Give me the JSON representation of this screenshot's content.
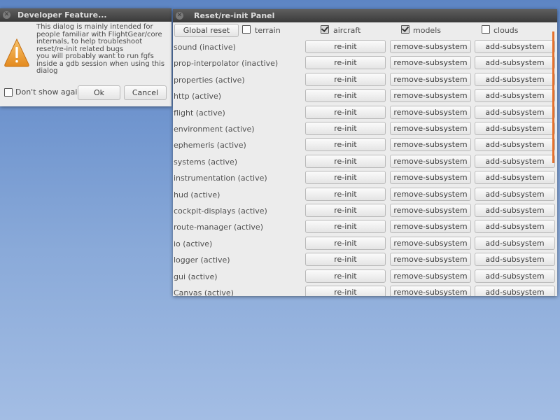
{
  "dev_dialog": {
    "title": "Developer Feature...",
    "message": "This dialog is mainly intended for people familiar with FlightGear/core internals, to help troubleshoot reset/re-init related bugs\nyou will probably want to run fgfs inside  a gdb session when using this dialog",
    "dont_show_label": "Don't show again.",
    "dont_show_checked": false,
    "ok_label": "Ok",
    "cancel_label": "Cancel",
    "icon": "warning-icon"
  },
  "reset_panel": {
    "title": "Reset/re-init Panel",
    "global_reset_label": "Global reset",
    "options": [
      {
        "label": "terrain",
        "checked": false
      },
      {
        "label": "aircraft",
        "checked": true
      },
      {
        "label": "models",
        "checked": true
      },
      {
        "label": "clouds",
        "checked": false
      }
    ],
    "action_labels": {
      "reinit": "re-init",
      "remove": "remove-subsystem",
      "add": "add-subsystem"
    },
    "subsystems": [
      {
        "name": "sound (inactive)"
      },
      {
        "name": "prop-interpolator (inactive)"
      },
      {
        "name": "properties (active)"
      },
      {
        "name": "http (active)"
      },
      {
        "name": "flight (active)"
      },
      {
        "name": "environment (active)"
      },
      {
        "name": "ephemeris (active)"
      },
      {
        "name": "systems (active)"
      },
      {
        "name": "instrumentation (active)"
      },
      {
        "name": "hud (active)"
      },
      {
        "name": "cockpit-displays (active)"
      },
      {
        "name": "route-manager (active)"
      },
      {
        "name": "io (active)"
      },
      {
        "name": "logger (active)"
      },
      {
        "name": "gui (active)"
      },
      {
        "name": "Canvas (active)"
      }
    ],
    "scrollbar_color": "#e5712d"
  }
}
